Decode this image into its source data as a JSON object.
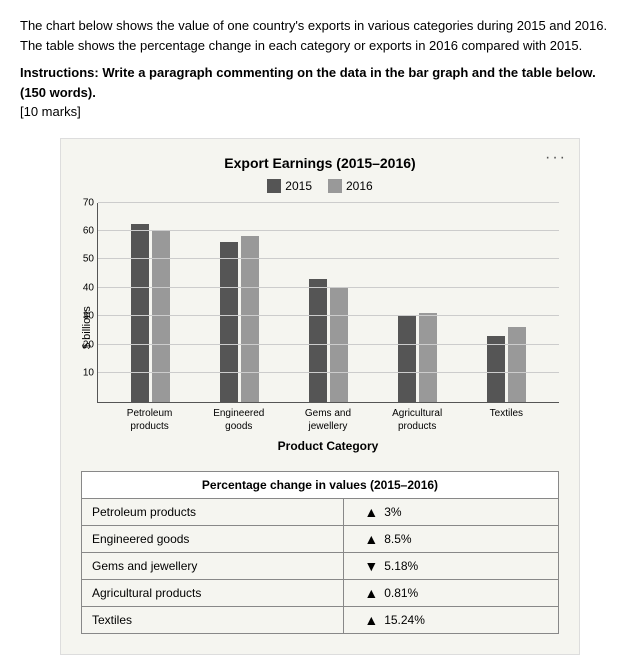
{
  "intro": {
    "text": "The chart below shows the value of one country's exports in various categories during 2015 and 2016. The table shows the percentage change in each category or exports in 2016 compared with 2015.",
    "instructions": "Instructions: Write a paragraph commenting on the data in the bar graph and the table below. (150 words).",
    "marks": "[10 marks]"
  },
  "chart": {
    "title": "Export Earnings (2015–2016)",
    "more_icon": "...",
    "legend": {
      "label_2015": "2015",
      "label_2016": "2016"
    },
    "y_axis_label": "$ billions",
    "y_ticks": [
      10,
      20,
      30,
      40,
      50,
      60,
      70
    ],
    "x_axis_title": "Product Category",
    "categories": [
      {
        "label": "Petroleum\nproducts",
        "value_2015": 62,
        "value_2016": 60
      },
      {
        "label": "Engineered\ngoods",
        "value_2015": 56,
        "value_2016": 58
      },
      {
        "label": "Gems and\njewellery",
        "value_2015": 43,
        "value_2016": 40
      },
      {
        "label": "Agricultural\nproducts",
        "value_2015": 30,
        "value_2016": 31
      },
      {
        "label": "Textiles",
        "value_2015": 23,
        "value_2016": 26
      }
    ]
  },
  "table": {
    "header": "Percentage change in values (2015–2016)",
    "rows": [
      {
        "category": "Petroleum products",
        "direction": "up",
        "value": "3%"
      },
      {
        "category": "Engineered goods",
        "direction": "up",
        "value": "8.5%"
      },
      {
        "category": "Gems and jewellery",
        "direction": "down",
        "value": "5.18%"
      },
      {
        "category": "Agricultural products",
        "direction": "up",
        "value": "0.81%"
      },
      {
        "category": "Textiles",
        "direction": "up",
        "value": "15.24%"
      }
    ]
  }
}
